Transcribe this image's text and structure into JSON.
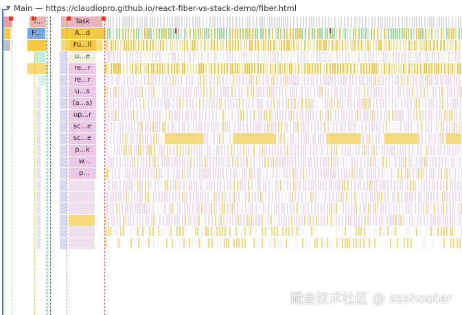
{
  "header": {
    "expand_icon": "triangle-down-icon",
    "title": "Main — https://claudiopro.github.io/react-fiber-vs-stack-demo/fiber.html"
  },
  "left_labels": [
    "T...",
    "P..."
  ],
  "call_stack": [
    "Task",
    "A...d",
    "Fu...ll",
    "u...e",
    "re...r",
    "re...r",
    "u...s",
    "(a...s)",
    "up...r",
    "sc...e",
    "sc...e",
    "p...k",
    "w...",
    "p..."
  ],
  "colors": {
    "task": "#d0d0d0",
    "script": "#f6c945",
    "purple": "#e8c8e4",
    "green": "#9bd89b",
    "blue": "#7aa7ea",
    "long_task": "#e03030"
  },
  "watermark": "掘金技术社区 @ ssshooter"
}
